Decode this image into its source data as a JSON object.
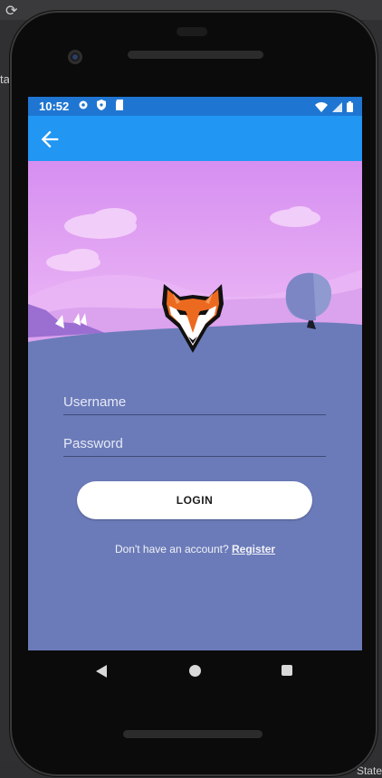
{
  "ide": {
    "side_text": "tar",
    "bottom_text": "State"
  },
  "status_bar": {
    "time": "10:52"
  },
  "app_bar": {
    "back_icon": "arrow-left-icon"
  },
  "login_form": {
    "username_placeholder": "Username",
    "password_placeholder": "Password",
    "login_button_label": "LOGIN",
    "register_prompt": "Don't have an account?",
    "register_link": "Register"
  },
  "colors": {
    "status_bar": "#1f76d2",
    "app_bar": "#2196f3",
    "screen_bg": "#6b7bb9",
    "sky_top": "#d98cf0",
    "hill": "#b38de6"
  },
  "nav_bar": {
    "icons": [
      "back-triangle-icon",
      "home-circle-icon",
      "recents-square-icon"
    ]
  }
}
